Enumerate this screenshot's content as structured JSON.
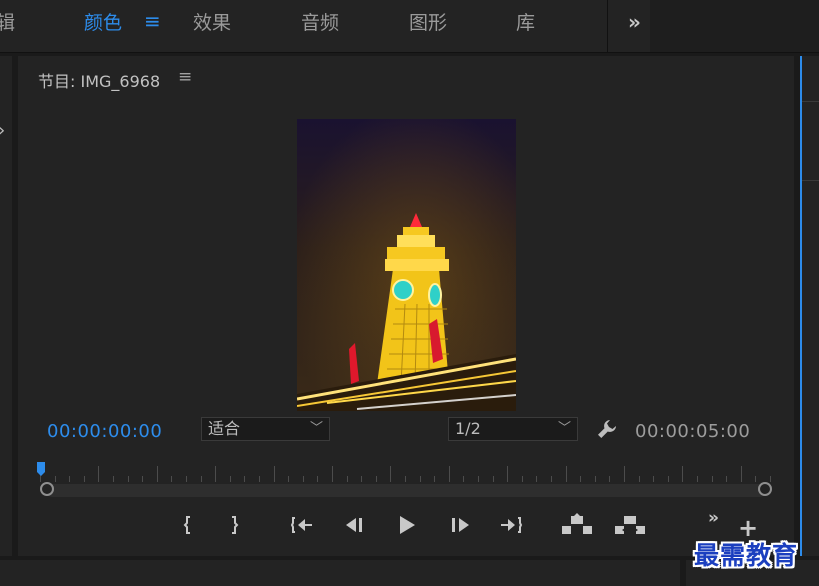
{
  "workspace_tabs": [
    {
      "label": "辑",
      "active": false
    },
    {
      "label": "颜色",
      "active": true
    },
    {
      "label": "效果",
      "active": false
    },
    {
      "label": "音频",
      "active": false
    },
    {
      "label": "图形",
      "active": false
    },
    {
      "label": "库",
      "active": false
    }
  ],
  "workspace_menu_icon": "≡",
  "workspace_overflow_icon": "»",
  "monitor": {
    "title": "节目: IMG_6968",
    "menu_icon": "≡",
    "current_timecode": "00:00:00:00",
    "duration_timecode": "00:00:05:00",
    "fit_select": {
      "value": "适合"
    },
    "resolution_select": {
      "value": "1/2"
    },
    "playhead_fraction": 0.0
  },
  "controls": {
    "overflow_icon": "»",
    "add_icon": "+"
  },
  "watermark": "最需教育",
  "colors": {
    "accent": "#2d8ceb",
    "panel": "#232323",
    "background": "#1a1a1a"
  }
}
